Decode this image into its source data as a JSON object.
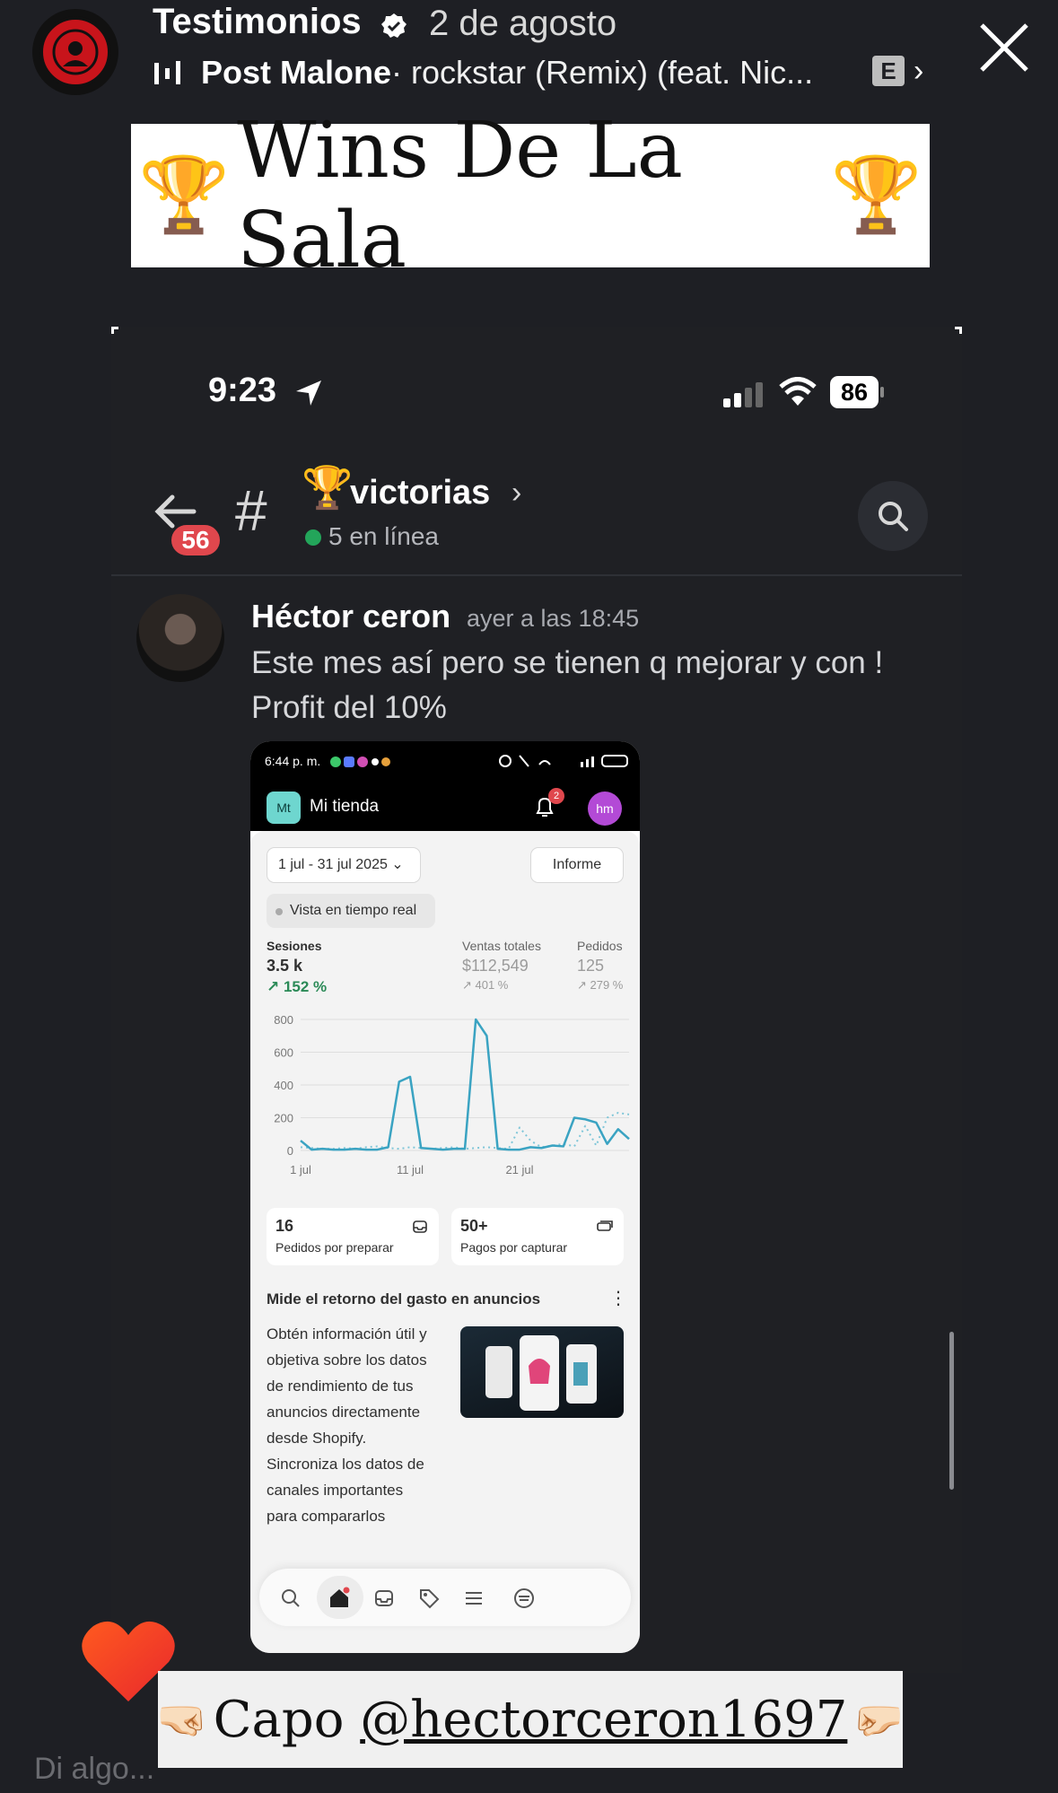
{
  "story": {
    "account": "Testimonios",
    "date": "2 de agosto",
    "music_artist": "Post Malone",
    "music_song": " · rockstar (Remix) (feat. Nic...",
    "explicit_badge": "E"
  },
  "banner": {
    "text": "Wins De La Sala",
    "trophy_left": "🏆",
    "trophy_right": "🏆"
  },
  "discord": {
    "time": "9:23",
    "battery": "86",
    "unread_count": "56",
    "hash": "#",
    "channel_emoji": "🏆",
    "channel_name": "victorias",
    "online": "5 en línea",
    "message": {
      "author": "Héctor ceron",
      "time": "ayer a las 18:45",
      "text": "Este mes así pero se tienen q mejorar y con ! Profit del 10%"
    }
  },
  "shopify": {
    "status_time": "6:44 p. m.",
    "store_initials": "Mt",
    "store_name": "Mi tienda",
    "notifications": "2",
    "user_initials": "hm",
    "date_range": "1 jul - 31 jul 2025 ⌄",
    "report_label": "Informe",
    "realtime_label": "Vista en tiempo real",
    "stats": [
      {
        "label": "Sesiones",
        "value": "3.5 k",
        "change": "↗ 152 %"
      },
      {
        "label": "Ventas totales",
        "value": "$112,549",
        "change": "↗ 401 %"
      },
      {
        "label": "Pedidos",
        "value": "125",
        "change": "↗ 279 %"
      }
    ],
    "cards": [
      {
        "value": "16",
        "label": "Pedidos por preparar"
      },
      {
        "value": "50+",
        "label": "Pagos por capturar"
      }
    ],
    "ads_title": "Mide el retorno del gasto en anuncios",
    "ads_more": "⋮",
    "ads_text": "Obtén información útil y objetiva sobre los datos de rendimiento de tus anuncios directamente desde Shopify. Sincroniza los datos de canales importantes para compararlos"
  },
  "chart_data": {
    "type": "line",
    "title": "",
    "xlabel": "",
    "ylabel": "",
    "ylim": [
      0,
      800
    ],
    "y_ticks": [
      "0",
      "200",
      "400",
      "600",
      "800"
    ],
    "x_tick_labels": [
      "1 jul",
      "11 jul",
      "21 jul"
    ],
    "x": [
      1,
      2,
      3,
      4,
      5,
      6,
      7,
      8,
      9,
      10,
      11,
      12,
      13,
      14,
      15,
      16,
      17,
      18,
      19,
      20,
      21,
      22,
      23,
      24,
      25,
      26,
      27,
      28,
      29,
      30,
      31
    ],
    "series": [
      {
        "values": [
          60,
          5,
          10,
          5,
          5,
          10,
          5,
          5,
          20,
          420,
          450,
          15,
          10,
          5,
          10,
          10,
          800,
          700,
          10,
          5,
          5,
          20,
          15,
          30,
          25,
          200,
          190,
          170,
          40,
          130,
          70
        ],
        "style": "solid",
        "color": "#3aa3c2"
      },
      {
        "values": [
          20,
          15,
          10,
          10,
          15,
          10,
          20,
          25,
          15,
          10,
          20,
          15,
          10,
          15,
          20,
          10,
          15,
          20,
          15,
          10,
          140,
          60,
          20,
          30,
          40,
          25,
          150,
          30,
          200,
          230,
          220
        ],
        "style": "dotted",
        "color": "#7fc6d8"
      }
    ]
  },
  "mention": {
    "text": "Capo ",
    "handle": "@hectorceron1697",
    "fist_left": "🤜🏻",
    "fist_right": "🤛🏻"
  },
  "reply": {
    "placeholder": "Di algo..."
  },
  "colors": {
    "accent_red": "#e0474d",
    "online_green": "#23a55a",
    "chart_line": "#3aa3c2",
    "gain_green": "#2b8a57"
  }
}
